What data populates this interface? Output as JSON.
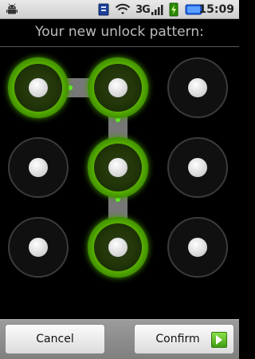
{
  "status_bar": {
    "time": "15:09",
    "network_type": "3G",
    "icons": [
      "android-debug-icon",
      "usb-icon",
      "wifi-icon",
      "signal-icon",
      "charging-icon",
      "battery-icon"
    ]
  },
  "title": "Your new unlock pattern:",
  "pattern": {
    "grid": [
      [
        "row1col1",
        "row1col2",
        "row1col3"
      ],
      [
        "row2col1",
        "row2col2",
        "row2col3"
      ],
      [
        "row3col1",
        "row3col2",
        "row3col3"
      ]
    ],
    "selected_sequence": [
      "row1col1",
      "row1col2",
      "row2col2",
      "row3col2"
    ],
    "active_color": "#7fe000",
    "inactive_color": "#2a2a2a"
  },
  "buttons": {
    "cancel_label": "Cancel",
    "confirm_label": "Confirm"
  },
  "colors": {
    "background": "#000000",
    "accent_green": "#78d600",
    "title_gray": "#bdbdbd"
  }
}
